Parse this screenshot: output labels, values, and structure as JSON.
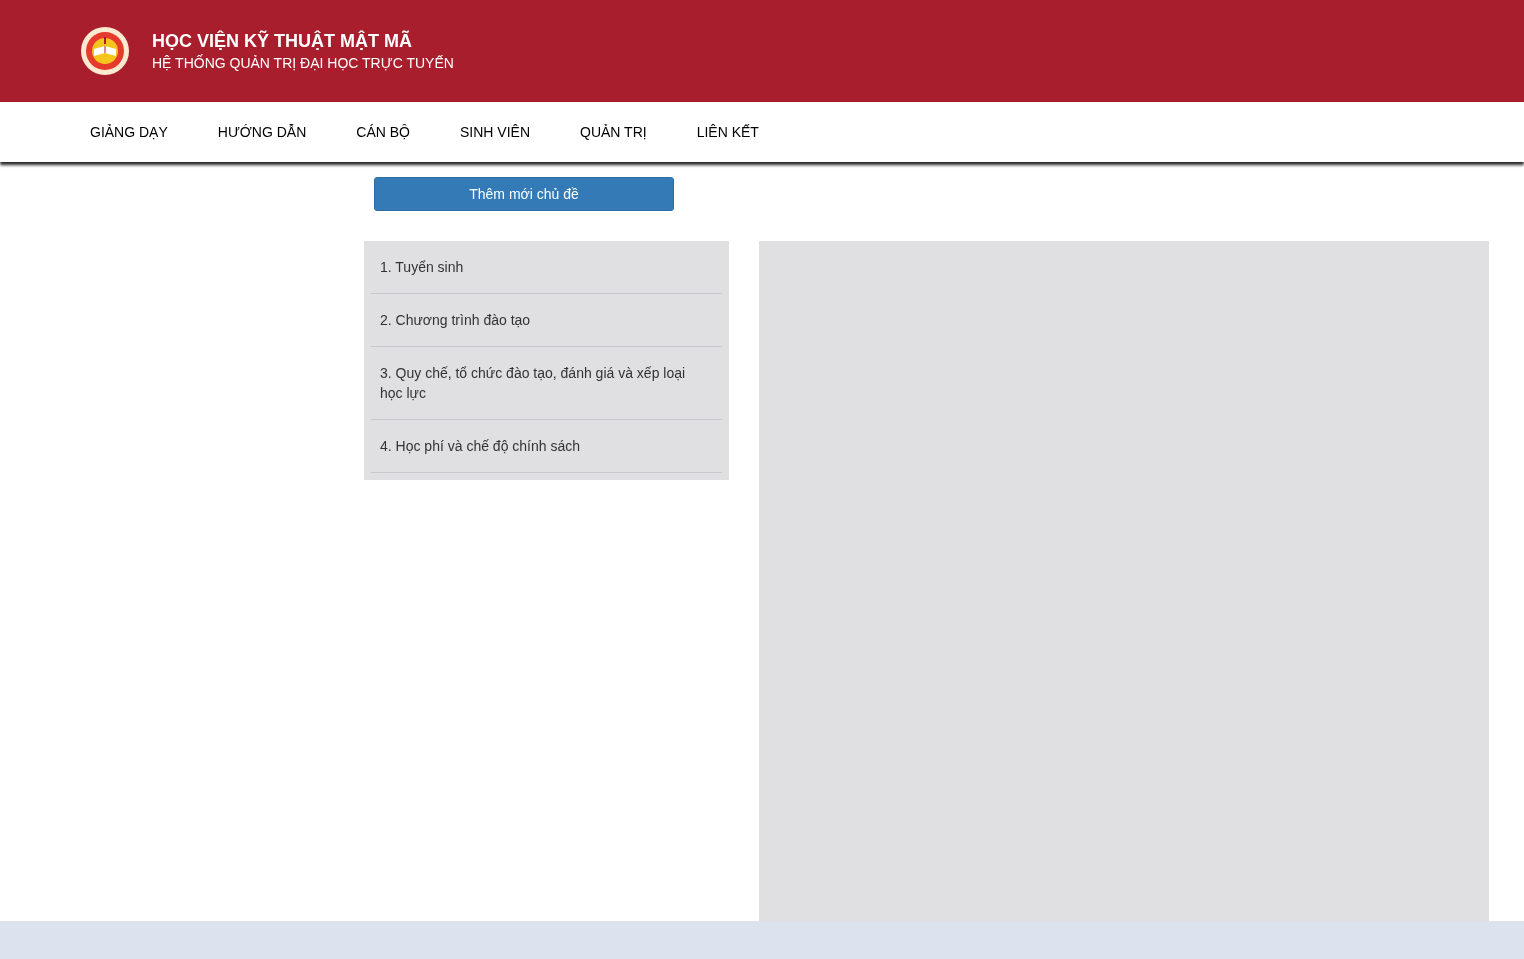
{
  "header": {
    "title": "HỌC VIỆN KỸ THUẬT MẬT MÃ",
    "subtitle": "HỆ THỐNG QUẢN TRỊ ĐẠI HỌC TRỰC TUYẾN"
  },
  "nav": [
    "GIẢNG DẠY",
    "HƯỚNG DẪN",
    "CÁN BỘ",
    "SINH VIÊN",
    "QUẢN TRỊ",
    "LIÊN KẾT"
  ],
  "add_button": "Thêm mới chủ đề",
  "topics": [
    "1. Tuyển sinh",
    "2. Chương trình đào tạo",
    "3. Quy chế, tổ chức đào tạo, đánh giá và xếp loại học lực",
    "4. Học phí và chế độ chính sách"
  ]
}
